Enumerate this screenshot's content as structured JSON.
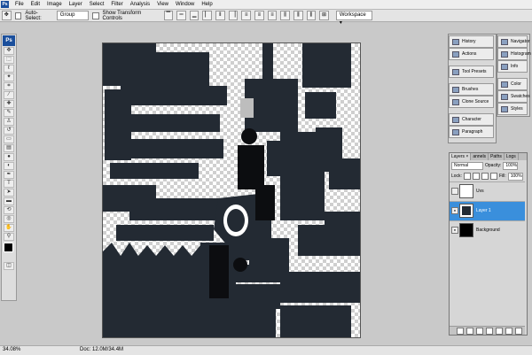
{
  "menubar": {
    "logo": "Ps",
    "items": [
      "File",
      "Edit",
      "Image",
      "Layer",
      "Select",
      "Filter",
      "Analysis",
      "View",
      "Window",
      "Help"
    ]
  },
  "options": {
    "auto_select_label": "Auto-Select:",
    "auto_select_value": "Group",
    "transform_label": "Show Transform Controls",
    "workspace_label": "Workspace ▾"
  },
  "toolbox": {
    "logo": "Ps"
  },
  "panels": {
    "history": "History",
    "actions": "Actions",
    "tool_presets": "Tool Presets",
    "brushes": "Brushes",
    "clone_source": "Clone Source",
    "character": "Character",
    "paragraph": "Paragraph",
    "navigator": "Navigator",
    "histogram": "Histogram",
    "info": "Info",
    "color": "Color",
    "swatches": "Swatches",
    "styles": "Styles"
  },
  "layers": {
    "tab_layers": "Layers ×",
    "tab_channels": "annels",
    "tab_paths": "Paths",
    "tab_logs": "Logs",
    "blend_mode": "Normal",
    "opacity_label": "Opacity:",
    "opacity_value": "100%",
    "fill_label": "Fill:",
    "fill_value": "100%",
    "lock_label": "Lock:",
    "items": [
      {
        "name": "Uvs"
      },
      {
        "name": "Layer 1"
      },
      {
        "name": "Background"
      }
    ]
  },
  "status": {
    "zoom": "34.08%",
    "doc": "Doc: 12.0M/34.4M"
  },
  "colors": {
    "accent": "#3a8fdc",
    "shape": "#232a33"
  }
}
